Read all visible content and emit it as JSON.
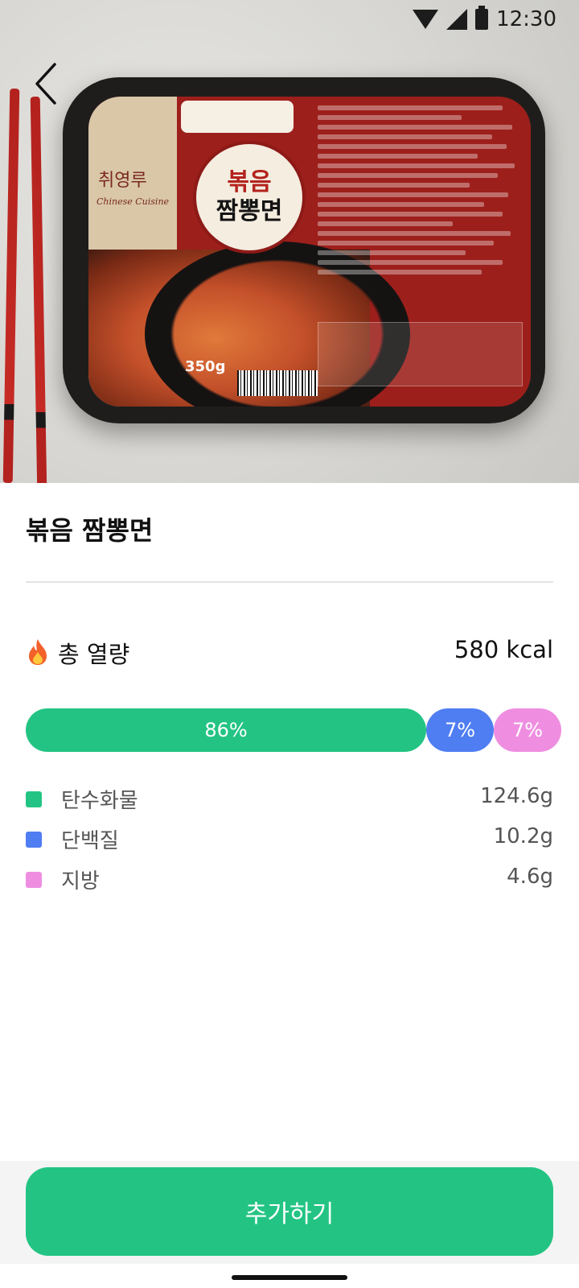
{
  "status_bar": {
    "time": "12:30",
    "icons": [
      "wifi-icon",
      "signal-icon",
      "battery-icon"
    ]
  },
  "nav": {
    "back_icon": "chevron-left-icon"
  },
  "hero": {
    "description_icon": "product-image",
    "package": {
      "brand_korean": "취영루",
      "brand_english": "Chinese Cuisine",
      "badge_line1": "볶음",
      "badge_line2": "짬뽕면",
      "weight": "350g"
    }
  },
  "product": {
    "name": "볶음 짬뽕면"
  },
  "calories": {
    "icon": "fire-icon",
    "label": "총 열량",
    "value": "580 kcal"
  },
  "macro_bar": {
    "segments": [
      {
        "key": "carb",
        "label": "86%",
        "percent": 86,
        "color": "#23c483"
      },
      {
        "key": "protein",
        "label": "7%",
        "percent": 7,
        "color": "#4f7df2"
      },
      {
        "key": "fat",
        "label": "7%",
        "percent": 7,
        "color": "#ef8ee0"
      }
    ]
  },
  "legend": [
    {
      "label": "탄수화물",
      "value": "124.6g",
      "color": "#23c483"
    },
    {
      "label": "단백질",
      "value": "10.2g",
      "color": "#4f7df2"
    },
    {
      "label": "지방",
      "value": "4.6g",
      "color": "#ef8ee0"
    }
  ],
  "actions": {
    "add_label": "추가하기"
  }
}
